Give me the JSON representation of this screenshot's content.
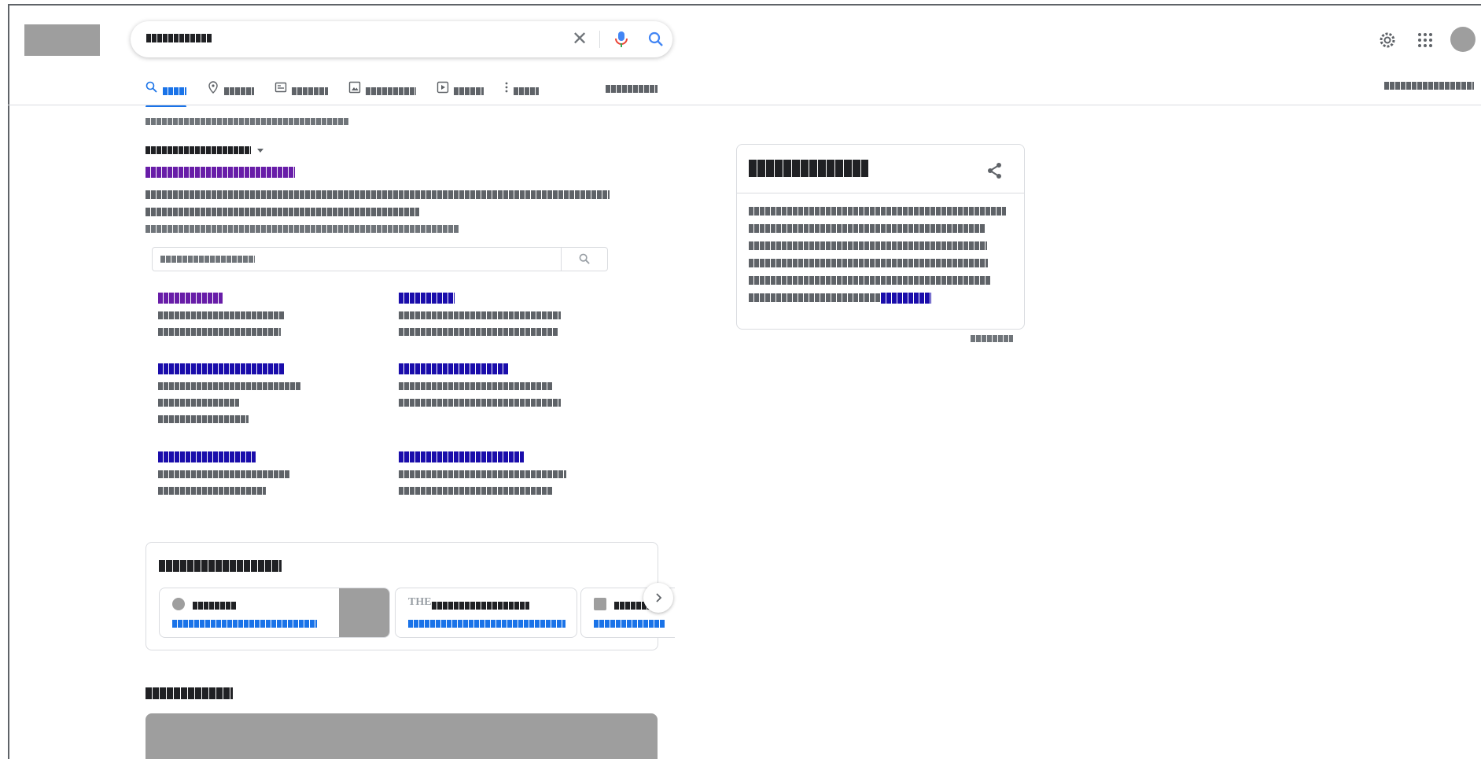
{
  "header": {
    "logo": "",
    "search_query": "██████████",
    "icons": {
      "clear": "close-icon",
      "mic": "mic-icon",
      "search": "search-icon",
      "settings": "gear-icon",
      "apps": "apps-grid-icon"
    }
  },
  "tabs": [
    {
      "label": "████",
      "icon": "search-icon",
      "active": true
    },
    {
      "label": "█████",
      "icon": "map-pin-icon",
      "active": false
    },
    {
      "label": "██████",
      "icon": "news-icon",
      "active": false
    },
    {
      "label": "█████████",
      "icon": "image-icon",
      "active": false
    },
    {
      "label": "█████",
      "icon": "video-icon",
      "active": false
    },
    {
      "label": "████",
      "icon": "more-vert-icon",
      "active": false
    }
  ],
  "tools_label": "████████",
  "safesearch_label": "████████████████",
  "result_stats": "██████████████████████████████████",
  "result": {
    "breadcrumb": "█████████████████████",
    "title": "████████████████████████",
    "snippet": [
      "████████████████████████████████████████████████████████████████████████████",
      "█████████████████████████████████████████████",
      "████████████████████████████████████████████████████"
    ],
    "site_search_placeholder": "████████████████████",
    "sitelinks": [
      {
        "title": "███████████",
        "desc": [
          "████████████████████",
          "███████████████████"
        ],
        "visited": true
      },
      {
        "title": "█████████",
        "desc": [
          "██████████████████████████",
          "████████████████████████"
        ],
        "visited": false
      },
      {
        "title": "████████████████████",
        "desc": [
          "█████████████████████",
          "█████████████",
          "██████████████"
        ],
        "visited": false
      },
      {
        "title": "██████████████████",
        "desc": [
          "████████████████████████",
          "███████████████████████████"
        ],
        "visited": false
      },
      {
        "title": "███████████████",
        "desc": [
          "█████████████████████",
          "████████████████"
        ],
        "visited": false
      },
      {
        "title": "████████████████████",
        "desc": [
          "██████████████████████████",
          "████████████████████████"
        ],
        "visited": false
      }
    ]
  },
  "top_stories": {
    "title": "████████████████████",
    "cards": [
      {
        "source": "████████",
        "headline": "████████████████████████████████"
      },
      {
        "source": "████████████████████",
        "headline": "██████████████████████████████████"
      },
      {
        "source": "████████",
        "headline": "██████████"
      }
    ]
  },
  "related_title": "█████████████",
  "knowledge_panel": {
    "title": "████████████",
    "lines": [
      "████████████████████████████████████████████",
      "████████████████████████████████████",
      "████████████████████████████████████████",
      "████████████████████████████████████████",
      "██████████████████████████████████████████",
      "█████████████████████████"
    ],
    "more_link": "█████████",
    "feedback": "████████"
  }
}
